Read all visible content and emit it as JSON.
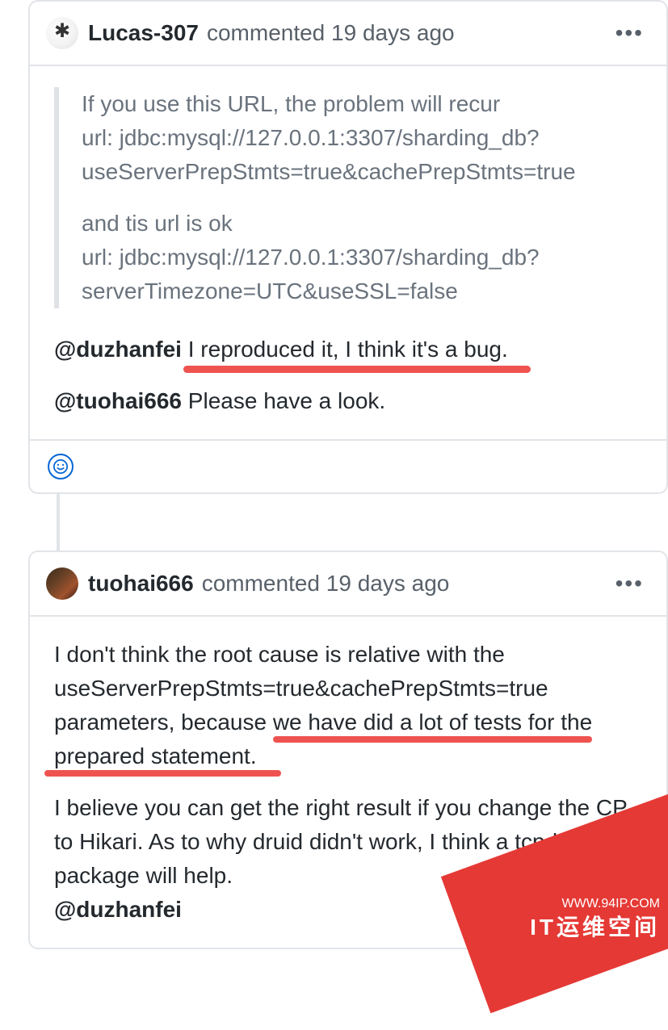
{
  "comments": [
    {
      "author": "Lucas-307",
      "meta_prefix": "commented",
      "timestamp": "19 days ago",
      "quote": {
        "p1_l1": "If you use this URL, the problem will recur",
        "p1_l2": "url: jdbc:mysql://127.0.0.1:3307/sharding_db?useServerPrepStmts=true&cachePrepStmts=true",
        "p2_l1": "and tis url is ok",
        "p2_l2": "url: jdbc:mysql://127.0.0.1:3307/sharding_db?serverTimezone=UTC&useSSL=false"
      },
      "line1_mention": "@duzhanfei",
      "line1_rest": " I reproduced it, I think it's a bug.",
      "line2_mention": "@tuohai666",
      "line2_rest": " Please have a look."
    },
    {
      "author": "tuohai666",
      "meta_prefix": "commented",
      "timestamp": "19 days ago",
      "p1_a": "I don't think the root cause is relative with the useServerPrepStmts=true&cachePrepStmts=true parameters, because ",
      "p1_b": "we have did a lot of tests for the",
      "p1_c": "prepared statement.",
      "p2": "I believe you can get the right result if you change the CP to Hikari. As to why druid didn't work, I think a tcpdump package will help.",
      "p2_mention": "@duzhanfei"
    }
  ],
  "watermark": {
    "line1": "WWW.94IP.COM",
    "line2": "IT运维空间"
  }
}
